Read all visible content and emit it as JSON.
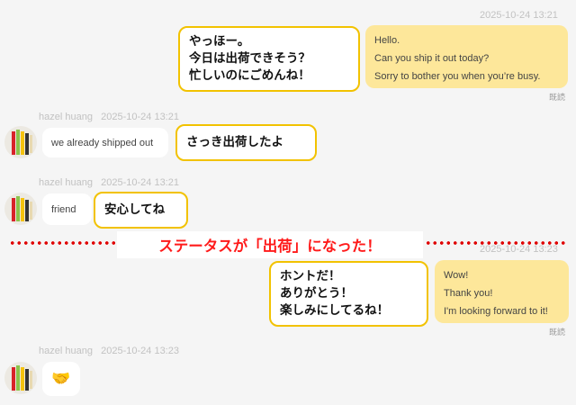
{
  "messages": {
    "m1": {
      "timestamp": "2025-10-24 13:21",
      "lines": [
        "Hello.",
        "Can you ship it out today?",
        "Sorry to bother you when you’re busy."
      ],
      "read": "既読",
      "annotation": "やっほー。\n今日は出荷できそう？\n忙しいのにごめんね！"
    },
    "m2": {
      "sender": "hazel huang",
      "timestamp": "2025-10-24 13:21",
      "text": "we already shipped out",
      "annotation": "さっき出荷したよ"
    },
    "m3": {
      "sender": "hazel huang",
      "timestamp": "2025-10-24 13:21",
      "text": "friend",
      "annotation": "安心してね"
    },
    "status_banner": "ステータスが「出荷」になった！",
    "m4": {
      "timestamp": "2025-10-24 13:23",
      "lines": [
        "Wow!",
        "Thank you!",
        "I'm looking forward to it!"
      ],
      "read": "既読",
      "annotation": "ホントだ！\nありがとう！\n楽しみにしてるね！"
    },
    "m5": {
      "sender": "hazel huang",
      "timestamp": "2025-10-24 13:23",
      "emoji": "🤝"
    }
  },
  "colors": {
    "background": "#f5f5f5",
    "user_bubble": "#fde79a",
    "callout_border": "#f2c200",
    "banner_text": "#ff1a1a",
    "muted_text": "#c2c2c2"
  },
  "icons": {
    "avatar": "avatar-icon",
    "handshake": "handshake-icon"
  }
}
